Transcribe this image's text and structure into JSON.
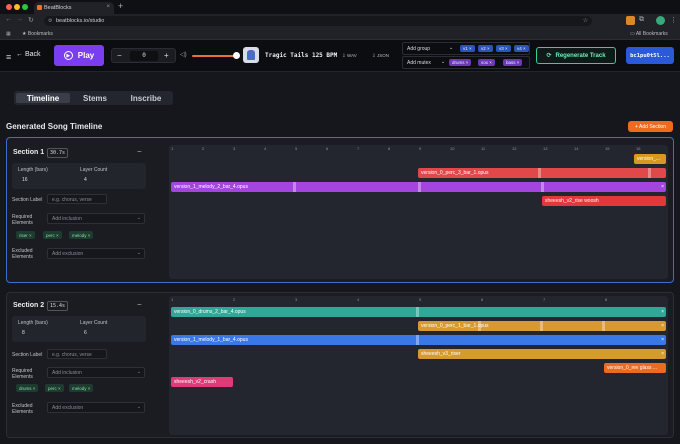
{
  "browser": {
    "tab_title": "BeatBlocks",
    "url": "beatblocks.io/studio",
    "bookmarks_label": "Bookmarks",
    "all_bookmarks_label": "All Bookmarks"
  },
  "header": {
    "back_label": "Back",
    "play_label": "Play",
    "tempo_value": "0",
    "minus": "−",
    "plus": "+",
    "track_title": "Tragic Tails 125 BPM",
    "wav_label": "WAV",
    "json_label": "JSON",
    "add_group_label": "Add group",
    "add_mutex_label": "Add mutex",
    "group_pills": [
      "v1 ×",
      "v2 ×",
      "v3 ×",
      "v4 ×"
    ],
    "mutex_pills": [
      "drums ×",
      "vox ×",
      "bass ×"
    ],
    "regenerate_label": "Regenerate Track",
    "wallet_label": "bc1pu0t5l..."
  },
  "view_tabs": [
    "Timeline",
    "Stems",
    "Inscribe"
  ],
  "page": {
    "title": "Generated Song Timeline",
    "add_section_label": "+ Add Section"
  },
  "sections": [
    {
      "title": "Section 1",
      "duration_badge": "30.7s",
      "collapse": "−",
      "length_label": "Length (bars)",
      "length_value": "16",
      "layer_label": "Layer Count",
      "layer_value": "4",
      "section_label_label": "Section Label",
      "section_label_placeholder": "e.g. chorus, verse",
      "required_label": "Required Elements",
      "add_inclusion": "Add inclusion",
      "required_chips": [
        "riser ×",
        "perc ×",
        "melody ×"
      ],
      "excluded_label": "Excluded Elements",
      "add_exclusion": "Add exclusion",
      "ruler": [
        "1",
        "2",
        "3",
        "4",
        "5",
        "6",
        "7",
        "8",
        "9",
        "10",
        "11",
        "12",
        "13",
        "14",
        "15",
        "16"
      ],
      "clips": [
        {
          "text": "version_...",
          "color": "#d79a1e"
        },
        {
          "text": "version_0_perc_3_bar_1.opus",
          "color": "#e0484a"
        },
        {
          "text": "version_1_melody_2_bar_4.opus",
          "color": "#a445e0"
        },
        {
          "text": "sheeesh_v2_rise woosh",
          "color": "#e0383c"
        }
      ]
    },
    {
      "title": "Section 2",
      "duration_badge": "15.4s",
      "collapse": "−",
      "length_label": "Length (bars)",
      "length_value": "8",
      "layer_label": "Layer Count",
      "layer_value": "6",
      "section_label_label": "Section Label",
      "section_label_placeholder": "e.g. chorus, verse",
      "required_label": "Required Elements",
      "add_inclusion": "Add inclusion",
      "required_chips": [
        "drums ×",
        "perc ×",
        "melody ×"
      ],
      "excluded_label": "Excluded Elements",
      "add_exclusion": "Add exclusion",
      "ruler": [
        "1",
        "2",
        "3",
        "4",
        "5",
        "6",
        "7",
        "8"
      ],
      "clips": [
        {
          "text": "version_0_drums_2_bar_4.opus",
          "color": "#2fa898"
        },
        {
          "text": "version_0_perc_1_bar_1.opus",
          "color": "#d79a2e"
        },
        {
          "text": "version_1_melody_1_bar_4.opus",
          "color": "#3a78e8"
        },
        {
          "text": "sheeesh_v3_riser",
          "color": "#d79a2e"
        },
        {
          "text": "version_0_rev glass ...",
          "color": "#ee6a1e"
        },
        {
          "text": "sheeesh_v2_crash",
          "color": "#e03a78"
        }
      ]
    }
  ]
}
